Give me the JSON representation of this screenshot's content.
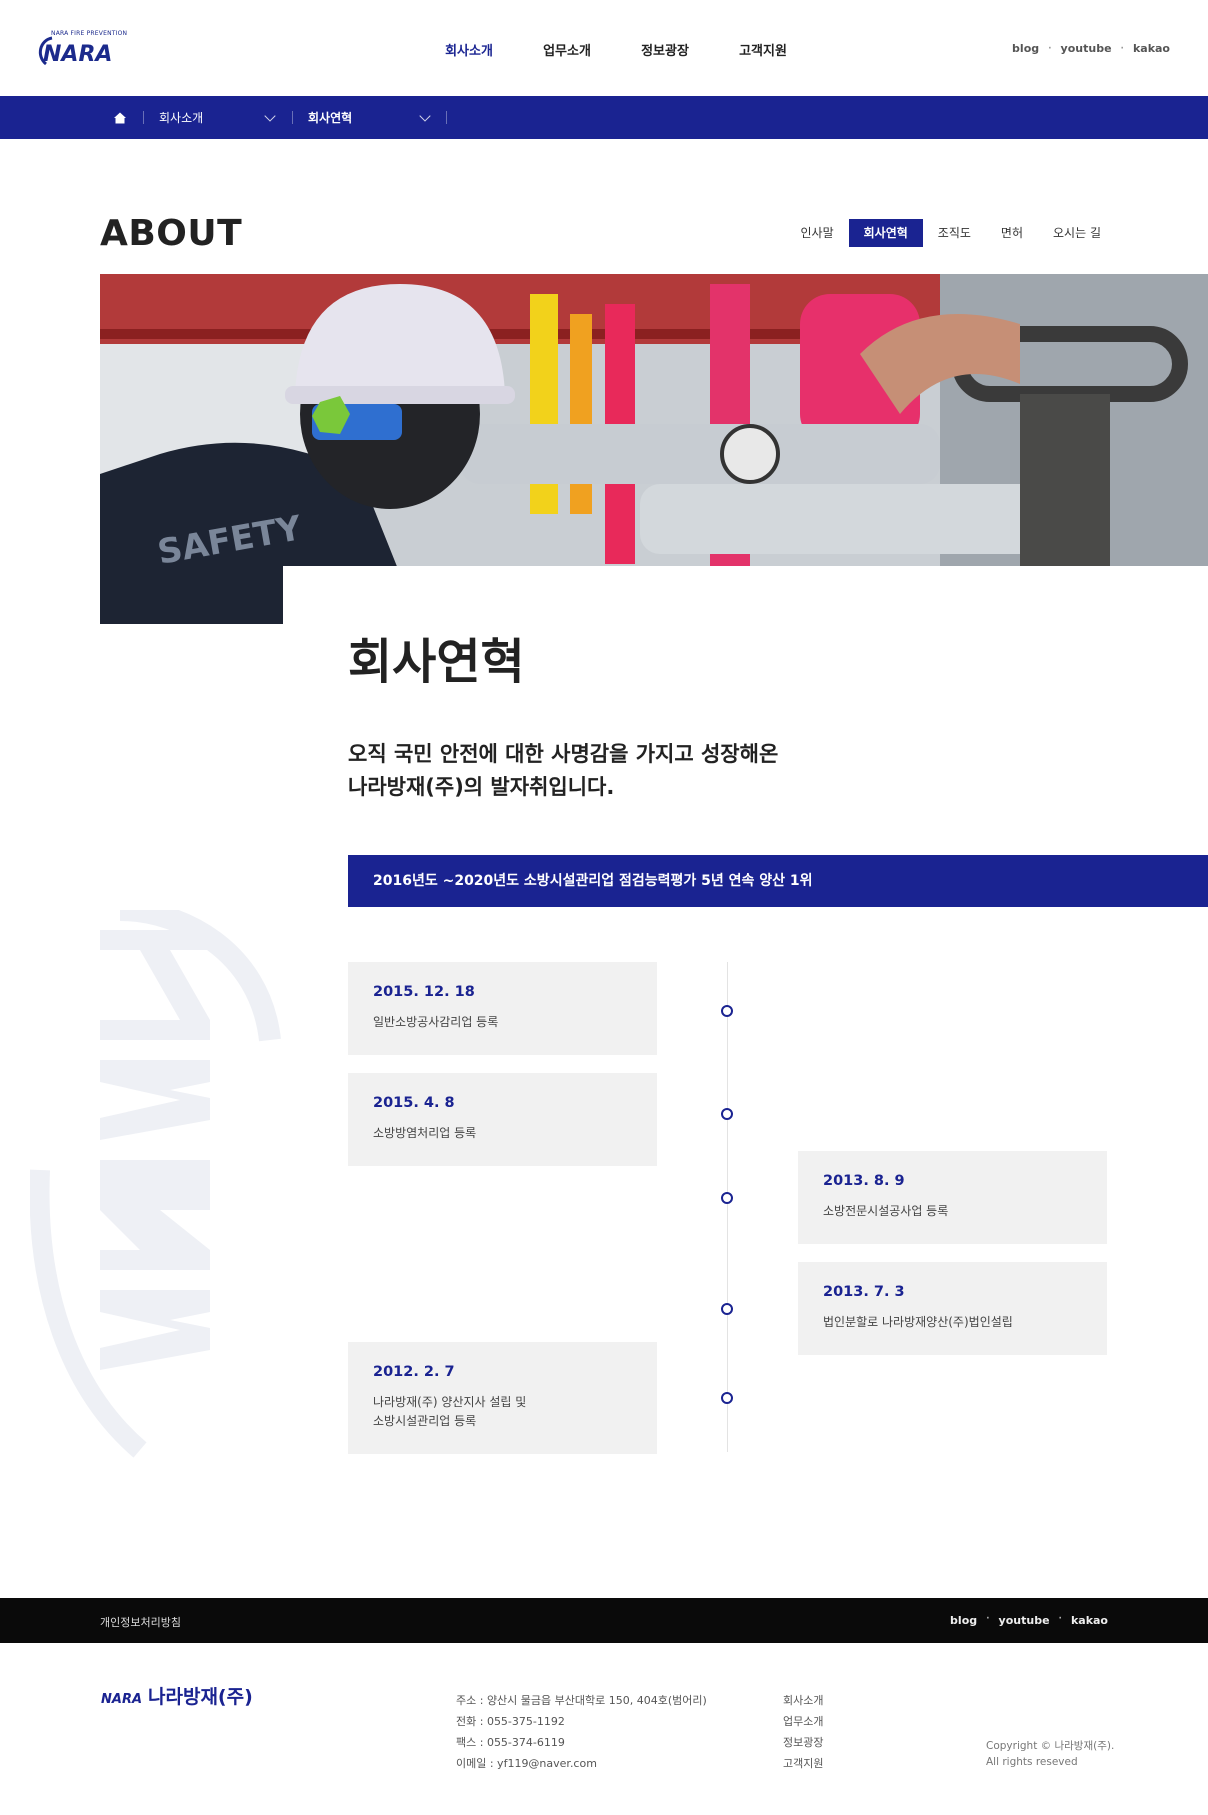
{
  "header": {
    "logo_caption": "NARA FIRE PREVENTION",
    "logo_text": "NARA",
    "nav": [
      "회사소개",
      "업무소개",
      "정보광장",
      "고객지원"
    ],
    "sns": [
      "blog",
      "youtube",
      "kakao"
    ]
  },
  "breadcrumb": {
    "home_icon": "home-icon",
    "level1": "회사소개",
    "level2": "회사연혁"
  },
  "page": {
    "section_label": "ABOUT",
    "tabs": [
      "인사말",
      "회사연혁",
      "조직도",
      "면허",
      "오시는 길"
    ],
    "active_tab": "회사연혁",
    "title": "회사연혁",
    "lead_line1": "오직 국민 안전에 대한 사명감을 가지고 성장해온",
    "lead_line2": "나라방재(주)의 발자취입니다.",
    "banner": "2016년도 ~2020년도 소방시설관리업 점검능력평가 5년 연속 양산 1위"
  },
  "timeline": [
    {
      "date": "2015. 12. 18",
      "desc": [
        "일반소방공사감리업 등록"
      ],
      "side": "left"
    },
    {
      "date": "2015. 4. 8",
      "desc": [
        "소방방염처리업 등록"
      ],
      "side": "left"
    },
    {
      "date": "2013. 8. 9",
      "desc": [
        "소방전문시설공사업 등록"
      ],
      "side": "right"
    },
    {
      "date": "2013. 7. 3",
      "desc": [
        "법인분할로 나라방재양산(주)법인설립"
      ],
      "side": "right"
    },
    {
      "date": "2012. 2. 7",
      "desc": [
        "나라방재(주) 양산지사 설립 및",
        "소방시설관리업 등록"
      ],
      "side": "left"
    }
  ],
  "footer": {
    "policy": "개인정보처리방침",
    "sns": [
      "blog",
      "youtube",
      "kakao"
    ],
    "logo_text": "NARA",
    "company": "나라방재(주)",
    "address": "주소 : 양산시 물금읍 부산대학로 150, 404호(범어리)",
    "phone": "전화 : 055-375-1192",
    "fax": "팩스 : 055-374-6119",
    "email": "이메일 : yf119@naver.com",
    "nav": [
      "회사소개",
      "업무소개",
      "정보광장",
      "고객지원"
    ],
    "copyright_1": "Copyright © 나라방재(주).",
    "copyright_2": "All rights reseved"
  },
  "colors": {
    "brand_navy": "#1a2391",
    "card_bg": "#f1f1f1",
    "footer_bar": "#0a0a0a"
  }
}
